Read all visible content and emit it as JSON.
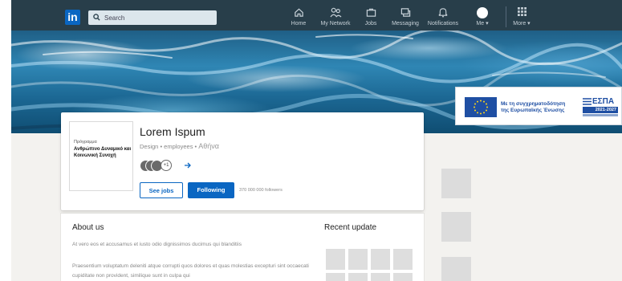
{
  "nav": {
    "logo": "in",
    "search_placeholder": "Search",
    "items": [
      {
        "label": "Home",
        "icon": "home-icon"
      },
      {
        "label": "My Network",
        "icon": "network-icon"
      },
      {
        "label": "Jobs",
        "icon": "briefcase-icon"
      },
      {
        "label": "Messaging",
        "icon": "messaging-icon"
      },
      {
        "label": "Notifications",
        "icon": "bell-icon"
      },
      {
        "label": "Me ▾",
        "icon": "avatar"
      },
      {
        "label": "More ▾",
        "icon": "grid-icon"
      }
    ]
  },
  "banner": {
    "eu_text_line1": "Με τη συγχρηματοδότηση",
    "eu_text_line2": "της Ευρωπαϊκής Ένωσης",
    "espa_title": "ΕΣΠΑ",
    "espa_years": "2021-2027"
  },
  "company": {
    "logo_line1": "Πρόγραμμα",
    "logo_line2": "Ανθρώπινο Δυναμικό και Κοινωνική Συνοχή",
    "name": "Lorem Ispum",
    "category": "Design",
    "employees_label": "employees",
    "city": "Αθήνα",
    "employees_more": "+1",
    "see_jobs": "See jobs",
    "following": "Following",
    "followers": "370 000 000 followers"
  },
  "about": {
    "title": "About us",
    "text1": "At vero eos et accusamus et iusto odio dignissimos ducimus qui blanditiis",
    "text2": "Praesentium voluptatum deleniti atque corrupti quos dolores et quas molestias excepturi sint occaecati cupiditate non provident, similique sunt in culpa qui",
    "recent_title": "Recent update"
  },
  "colors": {
    "nav_bg": "#283e4a",
    "brand_blue": "#0a66c2",
    "page_bg": "#f3f2ef",
    "eu_blue": "#1f4fa3"
  }
}
